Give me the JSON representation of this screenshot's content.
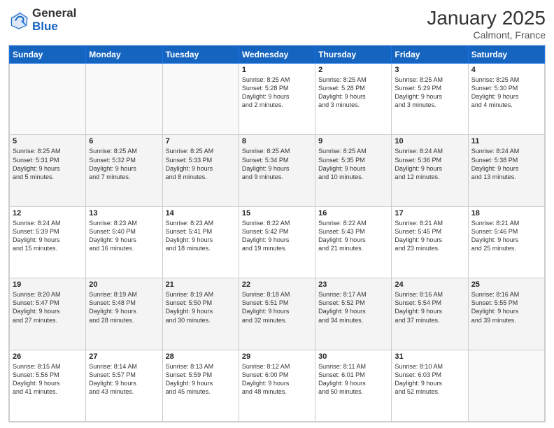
{
  "header": {
    "logo_general": "General",
    "logo_blue": "Blue",
    "title": "January 2025",
    "location": "Calmont, France"
  },
  "days_of_week": [
    "Sunday",
    "Monday",
    "Tuesday",
    "Wednesday",
    "Thursday",
    "Friday",
    "Saturday"
  ],
  "weeks": [
    [
      {
        "day": "",
        "info": ""
      },
      {
        "day": "",
        "info": ""
      },
      {
        "day": "",
        "info": ""
      },
      {
        "day": "1",
        "info": "Sunrise: 8:25 AM\nSunset: 5:28 PM\nDaylight: 9 hours\nand 2 minutes."
      },
      {
        "day": "2",
        "info": "Sunrise: 8:25 AM\nSunset: 5:28 PM\nDaylight: 9 hours\nand 3 minutes."
      },
      {
        "day": "3",
        "info": "Sunrise: 8:25 AM\nSunset: 5:29 PM\nDaylight: 9 hours\nand 3 minutes."
      },
      {
        "day": "4",
        "info": "Sunrise: 8:25 AM\nSunset: 5:30 PM\nDaylight: 9 hours\nand 4 minutes."
      }
    ],
    [
      {
        "day": "5",
        "info": "Sunrise: 8:25 AM\nSunset: 5:31 PM\nDaylight: 9 hours\nand 5 minutes."
      },
      {
        "day": "6",
        "info": "Sunrise: 8:25 AM\nSunset: 5:32 PM\nDaylight: 9 hours\nand 7 minutes."
      },
      {
        "day": "7",
        "info": "Sunrise: 8:25 AM\nSunset: 5:33 PM\nDaylight: 9 hours\nand 8 minutes."
      },
      {
        "day": "8",
        "info": "Sunrise: 8:25 AM\nSunset: 5:34 PM\nDaylight: 9 hours\nand 9 minutes."
      },
      {
        "day": "9",
        "info": "Sunrise: 8:25 AM\nSunset: 5:35 PM\nDaylight: 9 hours\nand 10 minutes."
      },
      {
        "day": "10",
        "info": "Sunrise: 8:24 AM\nSunset: 5:36 PM\nDaylight: 9 hours\nand 12 minutes."
      },
      {
        "day": "11",
        "info": "Sunrise: 8:24 AM\nSunset: 5:38 PM\nDaylight: 9 hours\nand 13 minutes."
      }
    ],
    [
      {
        "day": "12",
        "info": "Sunrise: 8:24 AM\nSunset: 5:39 PM\nDaylight: 9 hours\nand 15 minutes."
      },
      {
        "day": "13",
        "info": "Sunrise: 8:23 AM\nSunset: 5:40 PM\nDaylight: 9 hours\nand 16 minutes."
      },
      {
        "day": "14",
        "info": "Sunrise: 8:23 AM\nSunset: 5:41 PM\nDaylight: 9 hours\nand 18 minutes."
      },
      {
        "day": "15",
        "info": "Sunrise: 8:22 AM\nSunset: 5:42 PM\nDaylight: 9 hours\nand 19 minutes."
      },
      {
        "day": "16",
        "info": "Sunrise: 8:22 AM\nSunset: 5:43 PM\nDaylight: 9 hours\nand 21 minutes."
      },
      {
        "day": "17",
        "info": "Sunrise: 8:21 AM\nSunset: 5:45 PM\nDaylight: 9 hours\nand 23 minutes."
      },
      {
        "day": "18",
        "info": "Sunrise: 8:21 AM\nSunset: 5:46 PM\nDaylight: 9 hours\nand 25 minutes."
      }
    ],
    [
      {
        "day": "19",
        "info": "Sunrise: 8:20 AM\nSunset: 5:47 PM\nDaylight: 9 hours\nand 27 minutes."
      },
      {
        "day": "20",
        "info": "Sunrise: 8:19 AM\nSunset: 5:48 PM\nDaylight: 9 hours\nand 28 minutes."
      },
      {
        "day": "21",
        "info": "Sunrise: 8:19 AM\nSunset: 5:50 PM\nDaylight: 9 hours\nand 30 minutes."
      },
      {
        "day": "22",
        "info": "Sunrise: 8:18 AM\nSunset: 5:51 PM\nDaylight: 9 hours\nand 32 minutes."
      },
      {
        "day": "23",
        "info": "Sunrise: 8:17 AM\nSunset: 5:52 PM\nDaylight: 9 hours\nand 34 minutes."
      },
      {
        "day": "24",
        "info": "Sunrise: 8:16 AM\nSunset: 5:54 PM\nDaylight: 9 hours\nand 37 minutes."
      },
      {
        "day": "25",
        "info": "Sunrise: 8:16 AM\nSunset: 5:55 PM\nDaylight: 9 hours\nand 39 minutes."
      }
    ],
    [
      {
        "day": "26",
        "info": "Sunrise: 8:15 AM\nSunset: 5:56 PM\nDaylight: 9 hours\nand 41 minutes."
      },
      {
        "day": "27",
        "info": "Sunrise: 8:14 AM\nSunset: 5:57 PM\nDaylight: 9 hours\nand 43 minutes."
      },
      {
        "day": "28",
        "info": "Sunrise: 8:13 AM\nSunset: 5:59 PM\nDaylight: 9 hours\nand 45 minutes."
      },
      {
        "day": "29",
        "info": "Sunrise: 8:12 AM\nSunset: 6:00 PM\nDaylight: 9 hours\nand 48 minutes."
      },
      {
        "day": "30",
        "info": "Sunrise: 8:11 AM\nSunset: 6:01 PM\nDaylight: 9 hours\nand 50 minutes."
      },
      {
        "day": "31",
        "info": "Sunrise: 8:10 AM\nSunset: 6:03 PM\nDaylight: 9 hours\nand 52 minutes."
      },
      {
        "day": "",
        "info": ""
      }
    ]
  ]
}
